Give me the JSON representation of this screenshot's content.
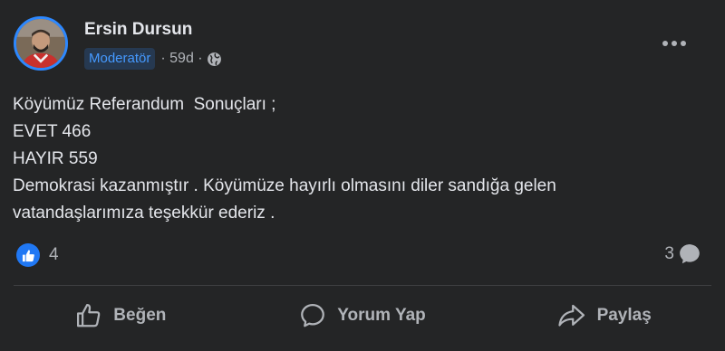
{
  "post": {
    "author": "Ersin Dursun",
    "badge": "Moderatör",
    "time": "· 59d ·",
    "body_lines": [
      "Köyümüz Referandum  Sonuçları ;",
      "EVET 466",
      "HAYIR 559",
      "Demokrasi kazanmıştır . Köyümüze hayırlı olmasını diler sandığa gelen",
      "vatandaşlarımıza teşekkür ederiz ."
    ],
    "reaction_count": "4",
    "comment_count": "3"
  },
  "actions": {
    "like_label": "Beğen",
    "comment_label": "Yorum Yap",
    "share_label": "Paylaş"
  },
  "colors": {
    "background": "#242526",
    "text": "#e4e6eb",
    "secondary_text": "#b0b3b8",
    "accent": "#2078f4",
    "badge_text": "#4599ff",
    "badge_background": "#263951"
  },
  "icons": {
    "avatar": "avatar",
    "globe": "globe-icon",
    "more": "more-options-icon",
    "like_reaction": "like-reaction-icon",
    "comment": "comment-icon",
    "like": "thumbs-up-icon",
    "comment_action": "speech-bubble-icon",
    "share": "share-arrow-icon"
  }
}
